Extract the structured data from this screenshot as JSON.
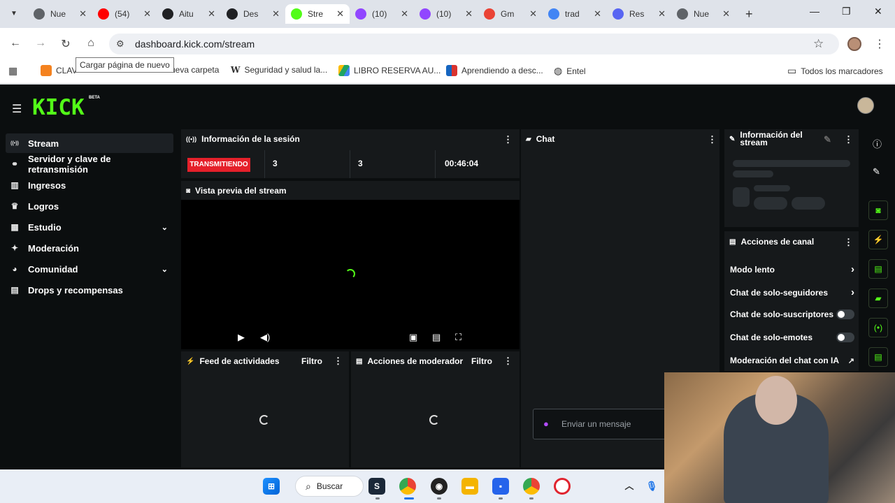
{
  "browser": {
    "tabs": [
      {
        "title": "Nue",
        "favicon": "chrome-icon",
        "color": "#5f6368"
      },
      {
        "title": "(54)",
        "favicon": "youtube-icon",
        "color": "#ff0000"
      },
      {
        "title": "Aitu",
        "favicon": "openai-icon",
        "color": "#202124"
      },
      {
        "title": "Des",
        "favicon": "openai-icon",
        "color": "#202124"
      },
      {
        "title": "Stre",
        "favicon": "kick-icon",
        "color": "#53fc18"
      },
      {
        "title": "(10)",
        "favicon": "twitch-icon",
        "color": "#9146ff"
      },
      {
        "title": "(10)",
        "favicon": "twitch-icon",
        "color": "#9146ff"
      },
      {
        "title": "Gm",
        "favicon": "gmail-icon",
        "color": "#ea4335"
      },
      {
        "title": "trad",
        "favicon": "google-icon",
        "color": "#4285f4"
      },
      {
        "title": "Res",
        "favicon": "discord-icon",
        "color": "#5865f2"
      },
      {
        "title": "Nue",
        "favicon": "chrome-icon",
        "color": "#5f6368"
      }
    ],
    "url": "dashboard.kick.com/stream",
    "tooltip": "Cargar página de nuevo",
    "bookmarks": [
      {
        "label": "CLAV",
        "color": "#f4821f"
      },
      {
        "label": "ueva carpeta",
        "color": "#ffffff"
      },
      {
        "label": "Seguridad y salud la...",
        "color": "#ffffff"
      },
      {
        "label": "LIBRO RESERVA AU...",
        "color": "#1fa463"
      },
      {
        "label": "Aprendiendo a desc...",
        "color": "#d9332f"
      },
      {
        "label": "Entel",
        "color": "#444"
      }
    ],
    "all_bookmarks": "Todos los marcadores"
  },
  "kick": {
    "logo": "KICK",
    "beta": "BETA",
    "accent": "#53fc18",
    "sidebar": [
      {
        "label": "Stream",
        "icon": "broadcast-icon",
        "active": true,
        "chevron": false
      },
      {
        "label": "Servidor y clave de retransmisión",
        "icon": "link-icon",
        "active": false,
        "chevron": false
      },
      {
        "label": "Ingresos",
        "icon": "chart-icon",
        "active": false,
        "chevron": false
      },
      {
        "label": "Logros",
        "icon": "trophy-icon",
        "active": false,
        "chevron": false
      },
      {
        "label": "Estudio",
        "icon": "layout-icon",
        "active": false,
        "chevron": true
      },
      {
        "label": "Moderación",
        "icon": "wrench-icon",
        "active": false,
        "chevron": false
      },
      {
        "label": "Comunidad",
        "icon": "community-icon",
        "active": false,
        "chevron": true
      },
      {
        "label": "Drops y recompensas",
        "icon": "gift-icon",
        "active": false,
        "chevron": false
      }
    ],
    "session": {
      "title": "Información de la sesión",
      "status": "TRANSMITIENDO",
      "viewers": "3",
      "followers": "3",
      "duration": "00:46:04"
    },
    "preview": {
      "title": "Vista previa del stream"
    },
    "feed": {
      "title": "Feed de actividades",
      "filter": "Filtro"
    },
    "mod_actions": {
      "title": "Acciones de moderador",
      "filter": "Filtro"
    },
    "chat": {
      "title": "Chat",
      "placeholder": "Enviar un mensaje"
    },
    "stream_info": {
      "title": "Información del stream"
    },
    "channel_actions": {
      "title": "Acciones de canal",
      "rows": [
        {
          "label": "Modo lento",
          "control": "chevron"
        },
        {
          "label": "Chat de solo-seguidores",
          "control": "chevron"
        },
        {
          "label": "Chat de solo-suscriptores",
          "control": "toggle"
        },
        {
          "label": "Chat de solo-emotes",
          "control": "toggle"
        },
        {
          "label": "Moderación del chat con IA",
          "control": "external"
        }
      ]
    }
  },
  "taskbar": {
    "search": "Buscar"
  }
}
